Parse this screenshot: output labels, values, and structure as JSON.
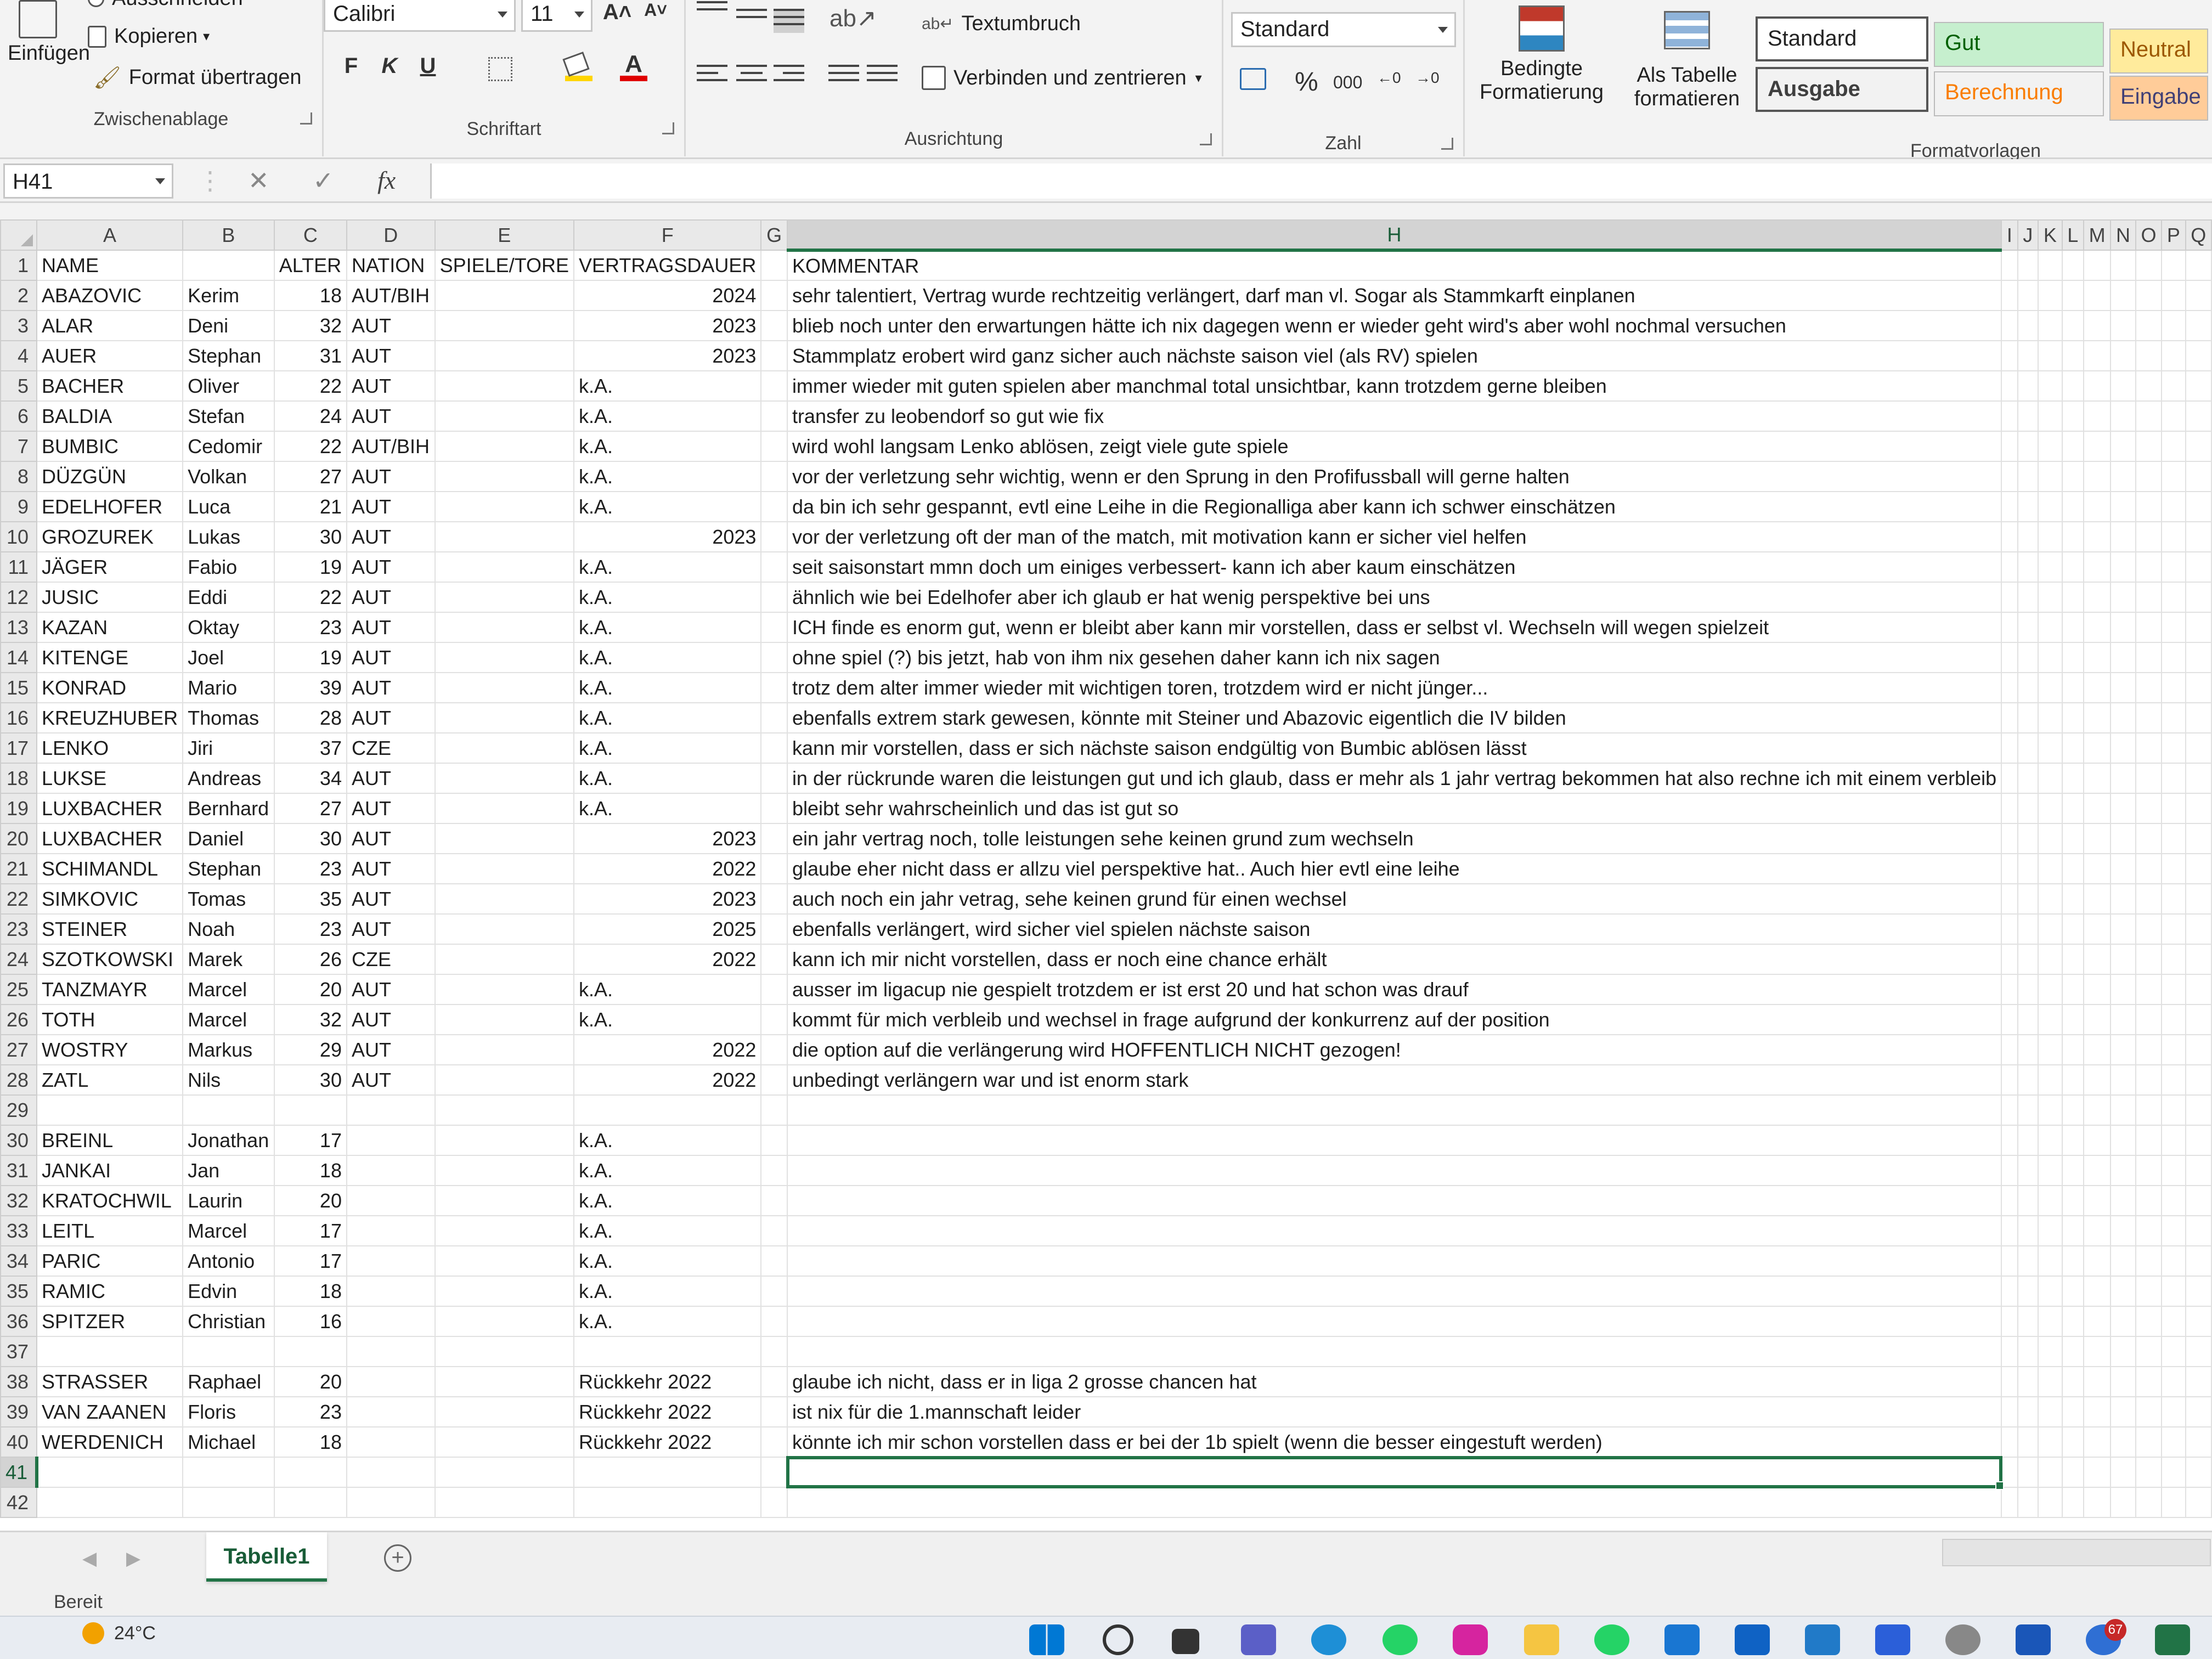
{
  "ribbon": {
    "clipboard": {
      "paste": "Einfügen",
      "cut": "Ausschneiden",
      "copy": "Kopieren",
      "format_painter": "Format übertragen",
      "group": "Zwischenablage"
    },
    "font": {
      "name": "Calibri",
      "size": "11",
      "bold": "F",
      "italic": "K",
      "underline": "U",
      "grow": "A˄",
      "shrink": "A˅",
      "group": "Schriftart"
    },
    "alignment": {
      "wrap": "Textumbruch",
      "merge": "Verbinden und zentrieren",
      "group": "Ausrichtung"
    },
    "number": {
      "format": "Standard",
      "percent": "%",
      "thousands": "000",
      "group": "Zahl"
    },
    "styles": {
      "conditional": [
        "Bedingte",
        "Formatierung"
      ],
      "as_table": [
        "Als Tabelle",
        "formatieren"
      ],
      "cells": [
        {
          "label": "Standard",
          "bg": "#ffffff",
          "color": "#222222"
        },
        {
          "label": "Gut",
          "bg": "#c6efce",
          "color": "#006100"
        },
        {
          "label": "Neutral",
          "bg": "#ffeb9c",
          "color": "#9c5700"
        },
        {
          "label": "Ausgabe",
          "bg": "#f2f2f2",
          "color": "#3f3f3f"
        },
        {
          "label": "Berechnung",
          "bg": "#f2f2f2",
          "color": "#fa7d00"
        },
        {
          "label": "Eingabe",
          "bg": "#ffcc99",
          "color": "#3f3f76"
        }
      ],
      "group": "Formatvorlagen"
    }
  },
  "formula_bar": {
    "name_box": "H41",
    "cancel": "✕",
    "enter": "✓",
    "fx": "fx",
    "value": ""
  },
  "columns": [
    "A",
    "B",
    "C",
    "D",
    "E",
    "F",
    "G",
    "H",
    "I",
    "J",
    "K",
    "L",
    "M",
    "N",
    "O",
    "P",
    "Q"
  ],
  "selected_cell": {
    "row": 41,
    "col": "H"
  },
  "rows": [
    {
      "n": 1,
      "A": "NAME",
      "B": "",
      "C": "ALTER",
      "D": "NATION",
      "E": "SPIELE/TORE",
      "F": "VERTRAGSDAUER",
      "H": "KOMMENTAR",
      "header": true
    },
    {
      "n": 2,
      "A": "ABAZOVIC",
      "B": "Kerim",
      "C": "18",
      "D": "AUT/BIH",
      "F": "2024",
      "H": "sehr talentiert, Vertrag wurde rechtzeitig verlängert, darf man vl. Sogar als Stammkarft einplanen"
    },
    {
      "n": 3,
      "A": "ALAR",
      "B": "Deni",
      "C": "32",
      "D": "AUT",
      "F": "2023",
      "H": "blieb noch unter den erwartungen hätte ich nix dagegen wenn er wieder geht wird's aber wohl nochmal versuchen"
    },
    {
      "n": 4,
      "A": "AUER",
      "B": "Stephan",
      "C": "31",
      "D": "AUT",
      "F": "2023",
      "H": "Stammplatz erobert wird ganz sicher auch nächste saison viel (als RV) spielen"
    },
    {
      "n": 5,
      "A": "BACHER",
      "B": "Oliver",
      "C": "22",
      "D": "AUT",
      "F": "k.A.",
      "H": "immer wieder mit guten spielen aber manchmal total unsichtbar, kann trotzdem gerne bleiben"
    },
    {
      "n": 6,
      "A": "BALDIA",
      "B": "Stefan",
      "C": "24",
      "D": "AUT",
      "F": "k.A.",
      "H": "transfer zu leobendorf so gut wie fix"
    },
    {
      "n": 7,
      "A": "BUMBIC",
      "B": "Cedomir",
      "C": "22",
      "D": "AUT/BIH",
      "F": "k.A.",
      "H": "wird wohl langsam Lenko ablösen, zeigt viele gute spiele"
    },
    {
      "n": 8,
      "A": "DÜZGÜN",
      "B": "Volkan",
      "C": "27",
      "D": "AUT",
      "F": "k.A.",
      "H": "vor der verletzung sehr wichtig, wenn er den Sprung in den Profifussball will gerne halten"
    },
    {
      "n": 9,
      "A": "EDELHOFER",
      "B": "Luca",
      "C": "21",
      "D": "AUT",
      "F": "k.A.",
      "H": "da bin ich sehr gespannt, evtl eine Leihe in die Regionalliga aber kann ich schwer einschätzen"
    },
    {
      "n": 10,
      "A": "GROZUREK",
      "B": "Lukas",
      "C": "30",
      "D": "AUT",
      "F": "2023",
      "H": "vor der verletzung oft der man of the match, mit motivation kann er sicher viel helfen"
    },
    {
      "n": 11,
      "A": "JÄGER",
      "B": "Fabio",
      "C": "19",
      "D": "AUT",
      "F": "k.A.",
      "H": "seit saisonstart mmn doch um einiges verbessert- kann ich aber kaum einschätzen"
    },
    {
      "n": 12,
      "A": "JUSIC",
      "B": "Eddi",
      "C": "22",
      "D": "AUT",
      "F": "k.A.",
      "H": "ähnlich wie bei Edelhofer aber ich glaub er hat wenig perspektive bei uns"
    },
    {
      "n": 13,
      "A": "KAZAN",
      "B": "Oktay",
      "C": "23",
      "D": "AUT",
      "F": "k.A.",
      "H": "ICH finde es enorm gut, wenn er bleibt aber kann mir vorstellen, dass er selbst vl. Wechseln will wegen spielzeit"
    },
    {
      "n": 14,
      "A": "KITENGE",
      "B": "Joel",
      "C": "19",
      "D": "AUT",
      "F": "k.A.",
      "H": "ohne spiel (?) bis jetzt, hab von ihm nix gesehen daher kann ich nix sagen"
    },
    {
      "n": 15,
      "A": "KONRAD",
      "B": "Mario",
      "C": "39",
      "D": "AUT",
      "F": "k.A.",
      "H": "trotz dem alter immer wieder mit wichtigen toren, trotzdem wird er nicht jünger..."
    },
    {
      "n": 16,
      "A": "KREUZHUBER",
      "B": "Thomas",
      "C": "28",
      "D": "AUT",
      "F": "k.A.",
      "H": "ebenfalls extrem stark gewesen, könnte mit Steiner und Abazovic eigentlich die IV bilden"
    },
    {
      "n": 17,
      "A": "LENKO",
      "B": "Jiri",
      "C": "37",
      "D": "CZE",
      "F": "k.A.",
      "H": "kann mir vorstellen, dass er sich nächste saison endgültig von Bumbic ablösen lässt"
    },
    {
      "n": 18,
      "A": "LUKSE",
      "B": "Andreas",
      "C": "34",
      "D": "AUT",
      "F": "k.A.",
      "H": "in der rückrunde waren die leistungen gut und ich glaub, dass er mehr als 1 jahr vertrag bekommen hat also rechne ich mit einem verbleib"
    },
    {
      "n": 19,
      "A": "LUXBACHER",
      "B": "Bernhard",
      "C": "27",
      "D": "AUT",
      "F": "k.A.",
      "H": "bleibt sehr wahrscheinlich und das ist gut so"
    },
    {
      "n": 20,
      "A": "LUXBACHER",
      "B": "Daniel",
      "C": "30",
      "D": "AUT",
      "F": "2023",
      "H": "ein jahr vertrag noch, tolle leistungen sehe keinen grund zum wechseln"
    },
    {
      "n": 21,
      "A": "SCHIMANDL",
      "B": "Stephan",
      "C": "23",
      "D": "AUT",
      "F": "2022",
      "H": "glaube eher nicht dass er allzu viel perspektive hat.. Auch hier evtl eine leihe"
    },
    {
      "n": 22,
      "A": "SIMKOVIC",
      "B": "Tomas",
      "C": "35",
      "D": "AUT",
      "F": "2023",
      "H": "auch noch ein jahr vetrag, sehe keinen grund für einen wechsel"
    },
    {
      "n": 23,
      "A": "STEINER",
      "B": "Noah",
      "C": "23",
      "D": "AUT",
      "F": "2025",
      "H": "ebenfalls verlängert, wird sicher viel spielen nächste saison"
    },
    {
      "n": 24,
      "A": "SZOTKOWSKI",
      "B": "Marek",
      "C": "26",
      "D": "CZE",
      "F": "2022",
      "H": "kann ich mir nicht vorstellen, dass er noch eine chance erhält"
    },
    {
      "n": 25,
      "A": "TANZMAYR",
      "B": "Marcel",
      "C": "20",
      "D": "AUT",
      "F": "k.A.",
      "H": "ausser im ligacup nie gespielt trotzdem er ist erst 20 und hat schon was drauf"
    },
    {
      "n": 26,
      "A": "TOTH",
      "B": "Marcel",
      "C": "32",
      "D": "AUT",
      "F": "k.A.",
      "H": "kommt für mich verbleib und wechsel in frage aufgrund der konkurrenz auf der position"
    },
    {
      "n": 27,
      "A": "WOSTRY",
      "B": "Markus",
      "C": "29",
      "D": "AUT",
      "F": "2022",
      "H": "die option auf die verlängerung wird HOFFENTLICH NICHT gezogen!"
    },
    {
      "n": 28,
      "A": "ZATL",
      "B": "Nils",
      "C": "30",
      "D": "AUT",
      "F": "2022",
      "H": "unbedingt verlängern war und ist enorm stark"
    },
    {
      "n": 29
    },
    {
      "n": 30,
      "A": "BREINL",
      "B": "Jonathan",
      "C": "17",
      "F": "k.A."
    },
    {
      "n": 31,
      "A": "JANKAI",
      "B": "Jan",
      "C": "18",
      "F": "k.A."
    },
    {
      "n": 32,
      "A": "KRATOCHWIL",
      "B": "Laurin",
      "C": "20",
      "F": "k.A."
    },
    {
      "n": 33,
      "A": "LEITL",
      "B": "Marcel",
      "C": "17",
      "F": "k.A."
    },
    {
      "n": 34,
      "A": "PARIC",
      "B": "Antonio",
      "C": "17",
      "F": "k.A."
    },
    {
      "n": 35,
      "A": "RAMIC",
      "B": "Edvin",
      "C": "18",
      "F": "k.A."
    },
    {
      "n": 36,
      "A": "SPITZER",
      "B": "Christian",
      "C": "16",
      "F": "k.A."
    },
    {
      "n": 37
    },
    {
      "n": 38,
      "A": "STRASSER",
      "B": "Raphael",
      "C": "20",
      "F": "Rückkehr 2022",
      "H": "glaube ich nicht, dass er in liga 2 grosse chancen hat"
    },
    {
      "n": 39,
      "A": "VAN ZAANEN",
      "B": "Floris",
      "C": "23",
      "F": "Rückkehr 2022",
      "H": "ist nix für die 1.mannschaft leider"
    },
    {
      "n": 40,
      "A": "WERDENICH",
      "B": "Michael",
      "C": "18",
      "F": "Rückkehr 2022",
      "H": "könnte ich mir schon vorstellen dass er bei der 1b spielt (wenn die besser eingestuft werden)"
    },
    {
      "n": 41
    },
    {
      "n": 42
    }
  ],
  "sheet_tabs": [
    "Tabelle1"
  ],
  "status": "Bereit",
  "taskbar": {
    "weather": "24°C",
    "badge": "67"
  },
  "colors": {
    "excel_green": "#217346"
  }
}
